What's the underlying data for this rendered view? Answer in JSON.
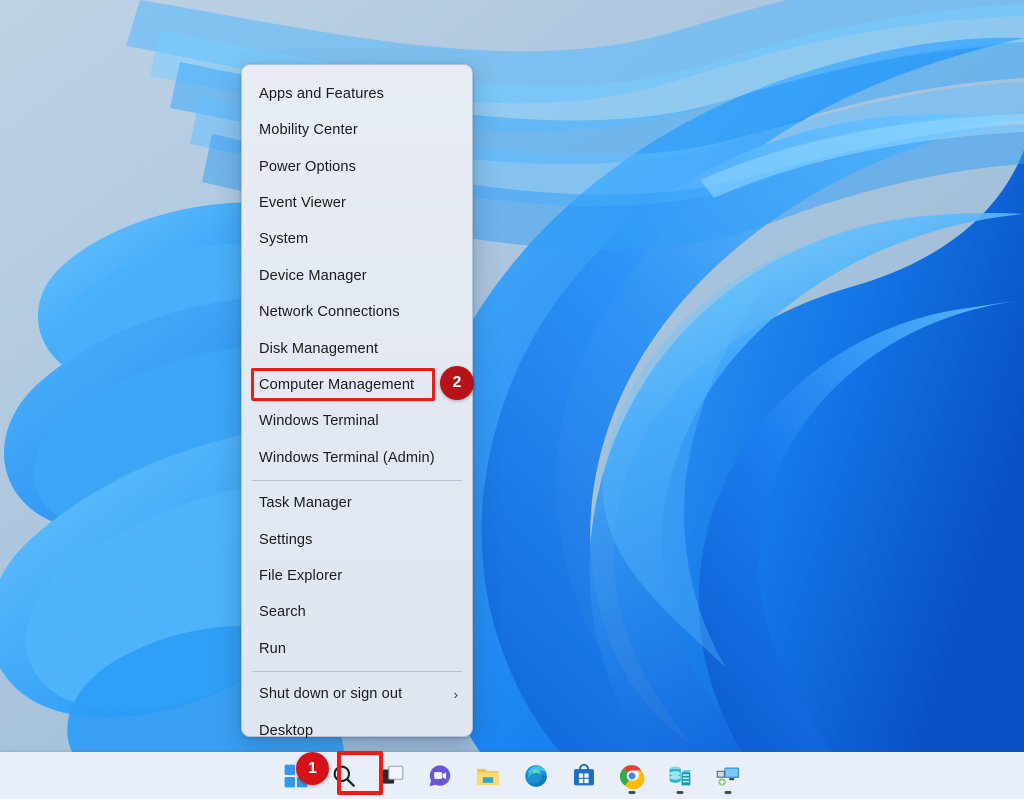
{
  "desktop": {
    "wallpaper_name": "windows-11-bloom-wallpaper",
    "background_color": "#a9c4dd",
    "accent_blue": "#1b7ef5"
  },
  "winx_menu": {
    "name": "Windows X power user menu",
    "background_color": "#e5eaf2",
    "groups": [
      {
        "items": [
          {
            "label": "Apps and Features",
            "icon": "",
            "submenu": false
          },
          {
            "label": "Mobility Center",
            "icon": "",
            "submenu": false
          },
          {
            "label": "Power Options",
            "icon": "",
            "submenu": false
          },
          {
            "label": "Event Viewer",
            "icon": "",
            "submenu": false
          },
          {
            "label": "System",
            "icon": "",
            "submenu": false
          },
          {
            "label": "Device Manager",
            "icon": "",
            "submenu": false
          },
          {
            "label": "Network Connections",
            "icon": "",
            "submenu": false
          },
          {
            "label": "Disk Management",
            "icon": "",
            "submenu": false
          },
          {
            "label": "Computer Management",
            "icon": "",
            "submenu": false,
            "highlighted": true
          },
          {
            "label": "Windows Terminal",
            "icon": "",
            "submenu": false
          },
          {
            "label": "Windows Terminal (Admin)",
            "icon": "",
            "submenu": false
          }
        ]
      },
      {
        "items": [
          {
            "label": "Task Manager",
            "icon": "",
            "submenu": false
          },
          {
            "label": "Settings",
            "icon": "",
            "submenu": false
          },
          {
            "label": "File Explorer",
            "icon": "",
            "submenu": false
          },
          {
            "label": "Search",
            "icon": "",
            "submenu": false
          },
          {
            "label": "Run",
            "icon": "",
            "submenu": false
          }
        ]
      },
      {
        "items": [
          {
            "label": "Shut down or sign out",
            "icon": "chevron-right-icon",
            "submenu": true,
            "chevron": "›"
          },
          {
            "label": "Desktop",
            "icon": "",
            "submenu": false
          }
        ]
      }
    ]
  },
  "annotations": {
    "highlight_color": "#ee1b16",
    "steps": [
      {
        "number": "1",
        "target": "start-button",
        "color": "#d4121a"
      },
      {
        "number": "2",
        "target": "computer-management-menu-item",
        "color": "#b61218"
      }
    ]
  },
  "taskbar": {
    "background_color": "#e9eff8",
    "items": [
      {
        "name": "start-button",
        "label": "Start",
        "icon": "windows-logo-icon",
        "running": false,
        "outlined": true
      },
      {
        "name": "search-button",
        "label": "Search",
        "icon": "search-icon",
        "running": false,
        "outlined": false
      },
      {
        "name": "task-view-button",
        "label": "Task View",
        "icon": "task-view-icon",
        "running": false,
        "outlined": false
      },
      {
        "name": "chat-button",
        "label": "Chat",
        "icon": "chat-video-icon",
        "running": false,
        "outlined": false
      },
      {
        "name": "file-explorer-button",
        "label": "File Explorer",
        "icon": "folder-icon",
        "running": false,
        "outlined": false
      },
      {
        "name": "edge-button",
        "label": "Microsoft Edge",
        "icon": "edge-icon",
        "running": false,
        "outlined": false
      },
      {
        "name": "store-button",
        "label": "Microsoft Store",
        "icon": "store-bag-icon",
        "running": false,
        "outlined": false
      },
      {
        "name": "chrome-button",
        "label": "Google Chrome",
        "icon": "chrome-icon",
        "running": true,
        "outlined": false
      },
      {
        "name": "server-button",
        "label": "Server Manager",
        "icon": "database-server-icon",
        "running": true,
        "outlined": false
      },
      {
        "name": "remote-desktop-button",
        "label": "Remote Desktop",
        "icon": "remote-desktop-icon",
        "running": true,
        "outlined": false
      }
    ]
  }
}
